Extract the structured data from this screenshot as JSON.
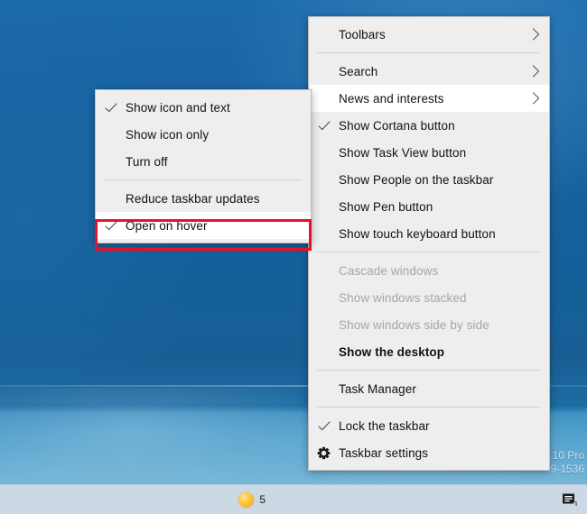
{
  "desktop": {
    "watermark_line1": "10 Pro",
    "watermark_line2": "9-1536"
  },
  "taskbar": {
    "weather_text": "5",
    "weather_icon": "sun-icon",
    "action_center_icon": "action-center-icon"
  },
  "main_menu": {
    "name": "taskbar-context-menu",
    "items": [
      {
        "label": "Toolbars",
        "checked": false,
        "arrow": true,
        "disabled": false,
        "hovered": false,
        "bold": false,
        "icon": null,
        "separator_after": true
      },
      {
        "label": "Search",
        "checked": false,
        "arrow": true,
        "disabled": false,
        "hovered": false,
        "bold": false,
        "icon": null,
        "separator_after": false
      },
      {
        "label": "News and interests",
        "checked": false,
        "arrow": true,
        "disabled": false,
        "hovered": true,
        "bold": false,
        "icon": null,
        "separator_after": false
      },
      {
        "label": "Show Cortana button",
        "checked": true,
        "arrow": false,
        "disabled": false,
        "hovered": false,
        "bold": false,
        "icon": null,
        "separator_after": false
      },
      {
        "label": "Show Task View button",
        "checked": false,
        "arrow": false,
        "disabled": false,
        "hovered": false,
        "bold": false,
        "icon": null,
        "separator_after": false
      },
      {
        "label": "Show People on the taskbar",
        "checked": false,
        "arrow": false,
        "disabled": false,
        "hovered": false,
        "bold": false,
        "icon": null,
        "separator_after": false
      },
      {
        "label": "Show Pen button",
        "checked": false,
        "arrow": false,
        "disabled": false,
        "hovered": false,
        "bold": false,
        "icon": null,
        "separator_after": false
      },
      {
        "label": "Show touch keyboard button",
        "checked": false,
        "arrow": false,
        "disabled": false,
        "hovered": false,
        "bold": false,
        "icon": null,
        "separator_after": true
      },
      {
        "label": "Cascade windows",
        "checked": false,
        "arrow": false,
        "disabled": true,
        "hovered": false,
        "bold": false,
        "icon": null,
        "separator_after": false
      },
      {
        "label": "Show windows stacked",
        "checked": false,
        "arrow": false,
        "disabled": true,
        "hovered": false,
        "bold": false,
        "icon": null,
        "separator_after": false
      },
      {
        "label": "Show windows side by side",
        "checked": false,
        "arrow": false,
        "disabled": true,
        "hovered": false,
        "bold": false,
        "icon": null,
        "separator_after": false
      },
      {
        "label": "Show the desktop",
        "checked": false,
        "arrow": false,
        "disabled": false,
        "hovered": false,
        "bold": true,
        "icon": null,
        "separator_after": true
      },
      {
        "label": "Task Manager",
        "checked": false,
        "arrow": false,
        "disabled": false,
        "hovered": false,
        "bold": false,
        "icon": null,
        "separator_after": true
      },
      {
        "label": "Lock the taskbar",
        "checked": true,
        "arrow": false,
        "disabled": false,
        "hovered": false,
        "bold": false,
        "icon": null,
        "separator_after": false
      },
      {
        "label": "Taskbar settings",
        "checked": false,
        "arrow": false,
        "disabled": false,
        "hovered": false,
        "bold": false,
        "icon": "gear-icon",
        "separator_after": false
      }
    ]
  },
  "sub_menu": {
    "name": "news-and-interests-submenu",
    "items": [
      {
        "label": "Show icon and text",
        "checked": true,
        "arrow": false,
        "disabled": false,
        "hovered": false,
        "bold": false,
        "icon": null,
        "separator_after": false
      },
      {
        "label": "Show icon only",
        "checked": false,
        "arrow": false,
        "disabled": false,
        "hovered": false,
        "bold": false,
        "icon": null,
        "separator_after": false
      },
      {
        "label": "Turn off",
        "checked": false,
        "arrow": false,
        "disabled": false,
        "hovered": false,
        "bold": false,
        "icon": null,
        "separator_after": true
      },
      {
        "label": "Reduce taskbar updates",
        "checked": false,
        "arrow": false,
        "disabled": false,
        "hovered": false,
        "bold": false,
        "icon": null,
        "separator_after": false
      },
      {
        "label": "Open on hover",
        "checked": true,
        "arrow": false,
        "disabled": false,
        "hovered": true,
        "bold": false,
        "icon": null,
        "separator_after": false
      }
    ]
  },
  "annotation": {
    "highlight_color": "#e8112d",
    "target_label": "Open on hover"
  }
}
